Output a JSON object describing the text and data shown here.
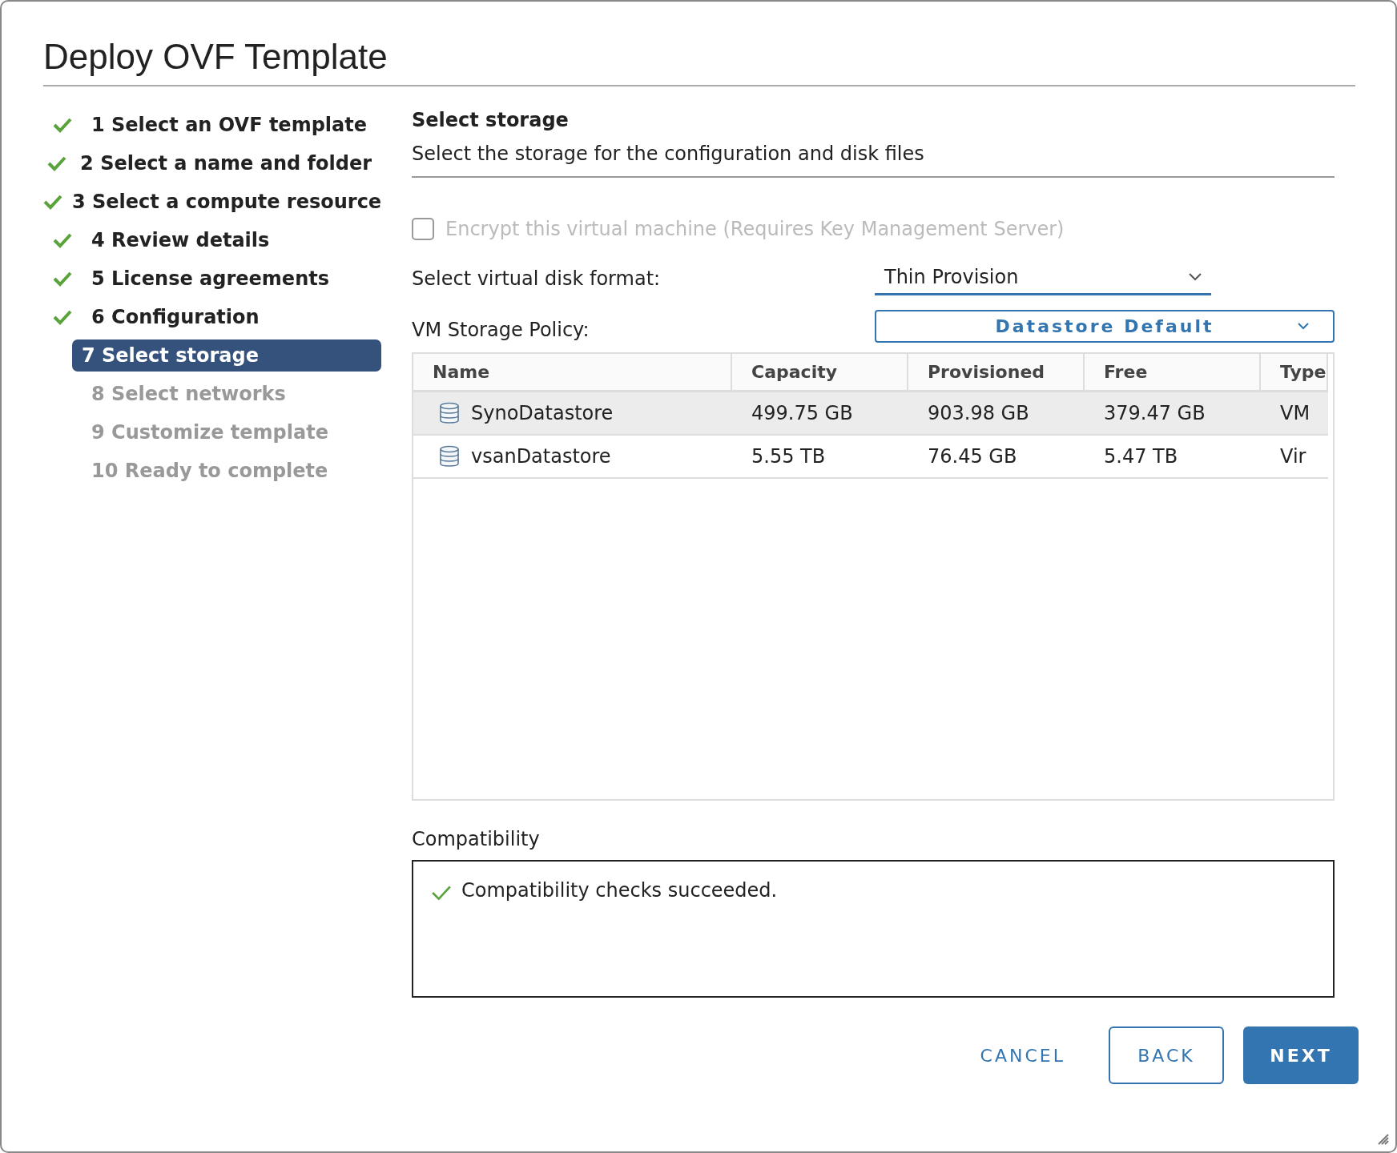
{
  "window": {
    "title": "Deploy OVF Template"
  },
  "steps": [
    {
      "label": "1 Select an OVF template",
      "completed": true,
      "selected": false,
      "disabled": false
    },
    {
      "label": "2 Select a name and folder",
      "completed": true,
      "selected": false,
      "disabled": false
    },
    {
      "label": "3 Select a compute resource",
      "completed": true,
      "selected": false,
      "disabled": false
    },
    {
      "label": "4 Review details",
      "completed": true,
      "selected": false,
      "disabled": false
    },
    {
      "label": "5 License agreements",
      "completed": true,
      "selected": false,
      "disabled": false
    },
    {
      "label": "6 Configuration",
      "completed": true,
      "selected": false,
      "disabled": false
    },
    {
      "label": "7 Select storage",
      "completed": false,
      "selected": true,
      "disabled": false
    },
    {
      "label": "8 Select networks",
      "completed": false,
      "selected": false,
      "disabled": true
    },
    {
      "label": "9 Customize template",
      "completed": false,
      "selected": false,
      "disabled": true
    },
    {
      "label": "10 Ready to complete",
      "completed": false,
      "selected": false,
      "disabled": true
    }
  ],
  "page": {
    "heading": "Select storage",
    "subtitle": "Select the storage for the configuration and disk files"
  },
  "encrypt": {
    "label": "Encrypt this virtual machine (Requires Key Management Server)",
    "checked": false,
    "disabled": true
  },
  "disk_format": {
    "label": "Select virtual disk format:",
    "value": "Thin Provision"
  },
  "storage_policy": {
    "label": "VM Storage Policy:",
    "value": "Datastore Default"
  },
  "table": {
    "columns": [
      "Name",
      "Capacity",
      "Provisioned",
      "Free",
      "Type"
    ],
    "rows": [
      {
        "cells": [
          "SynoDatastore",
          "499.75 GB",
          "903.98 GB",
          "379.47 GB",
          "VM"
        ],
        "selected": true
      },
      {
        "cells": [
          "vsanDatastore",
          "5.55 TB",
          "76.45 GB",
          "5.47 TB",
          "Vir"
        ],
        "selected": false
      }
    ]
  },
  "compatibility": {
    "label": "Compatibility",
    "message": "Compatibility checks succeeded."
  },
  "buttons": [
    {
      "label": "CANCEL",
      "kind": "flat"
    },
    {
      "label": "BACK",
      "kind": "outline"
    },
    {
      "label": "NEXT",
      "kind": "primary"
    }
  ]
}
